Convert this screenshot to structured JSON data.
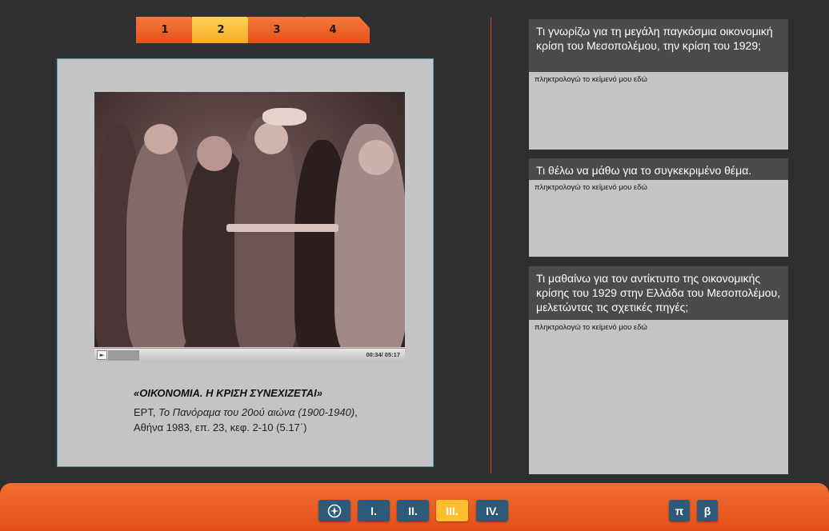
{
  "tabs": [
    {
      "label": "1",
      "active": false
    },
    {
      "label": "2",
      "active": true
    },
    {
      "label": "3",
      "active": false
    },
    {
      "label": "4",
      "active": false
    }
  ],
  "video": {
    "play_icon": "play-icon",
    "time": "00:34/ 05:17",
    "progress_fraction": 0.1
  },
  "caption": {
    "title": "«ΟΙΚΟΝΟΜΙΑ. Η ΚΡΙΣΗ ΣΥΝΕΧΙΖΕΤΑΙ»",
    "source_prefix": "ΕΡΤ, ",
    "source_italic": "Το Πανόραμα του 20ού αιώνα (1900-1940)",
    "source_suffix": ", Αθήνα 1983, επ. 23, κεφ. 2-10 (5.17΄)"
  },
  "questions": [
    {
      "heading": "Τι γνωρίζω για τη μεγάλη παγκόσμια οικονομική κρίση του Μεσοπολέμου, την κρίση του 1929;",
      "placeholder": "πληκτρολογώ το κείμενό μου εδώ"
    },
    {
      "heading": "Τι  θέλω να μάθω για το συγκεκριμένο θέμα.",
      "placeholder": "πληκτρολογώ το κείμενό μου εδώ"
    },
    {
      "heading": "Τι μαθαίνω για τον αντίκτυπο της οικονομικής κρίσης του 1929 στην Ελλάδα του Μεσοπολέμου, μελετώντας τις σχετικές πηγές;",
      "placeholder": "πληκτρολογώ το κείμενό μου εδώ"
    }
  ],
  "bottom_nav": {
    "compass_icon": "compass-icon",
    "sections": [
      {
        "label": "I.",
        "active": false
      },
      {
        "label": "II.",
        "active": false
      },
      {
        "label": "III.",
        "active": true
      },
      {
        "label": "IV.",
        "active": false
      }
    ],
    "pi_label": "π",
    "beta_label": "β"
  },
  "colors": {
    "accent_orange": "#e5501a",
    "active_yellow": "#ffbe2e",
    "nav_blue": "#2c5a78",
    "background": "#2f2f31"
  }
}
